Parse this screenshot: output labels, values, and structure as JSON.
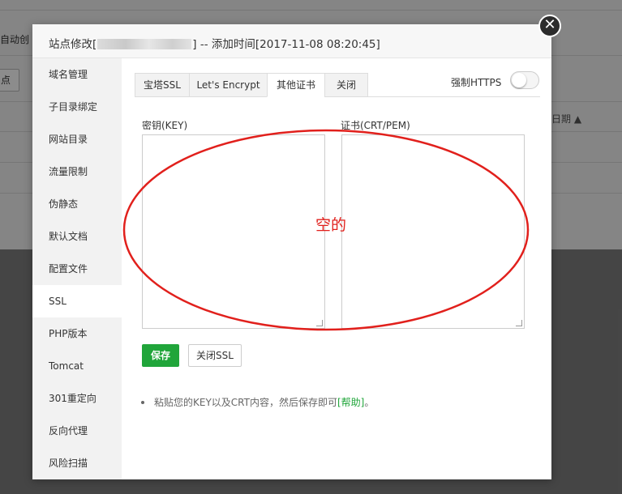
{
  "background": {
    "auto_text": "自动创",
    "button_text": "点",
    "date_header": "日期 ▲"
  },
  "modal": {
    "title_prefix": "站点修改[",
    "title_suffix": "] -- 添加时间[2017-11-08 08:20:45]",
    "close_icon": "close-icon"
  },
  "sidebar": {
    "items": [
      {
        "label": "域名管理"
      },
      {
        "label": "子目录绑定"
      },
      {
        "label": "网站目录"
      },
      {
        "label": "流量限制"
      },
      {
        "label": "伪静态"
      },
      {
        "label": "默认文档"
      },
      {
        "label": "配置文件"
      },
      {
        "label": "SSL"
      },
      {
        "label": "PHP版本"
      },
      {
        "label": "Tomcat"
      },
      {
        "label": "301重定向"
      },
      {
        "label": "反向代理"
      },
      {
        "label": "风险扫描"
      }
    ],
    "active": "SSL"
  },
  "tabs": [
    {
      "label": "宝塔SSL"
    },
    {
      "label": "Let's Encrypt"
    },
    {
      "label": "其他证书"
    },
    {
      "label": "关闭"
    }
  ],
  "active_tab": "其他证书",
  "force_https": {
    "label": "强制HTTPS",
    "enabled": false
  },
  "form": {
    "key_label": "密钥(KEY)",
    "key_value": "",
    "cert_label": "证书(CRT/PEM)",
    "cert_value": ""
  },
  "buttons": {
    "save": "保存",
    "close_ssl": "关闭SSL"
  },
  "tip": {
    "text": "粘贴您的KEY以及CRT内容，然后保存即可",
    "link": "[帮助]",
    "end": "。"
  },
  "annotation": {
    "text": "空的",
    "color": "#e1201c"
  },
  "colors": {
    "accent": "#20a53a"
  }
}
